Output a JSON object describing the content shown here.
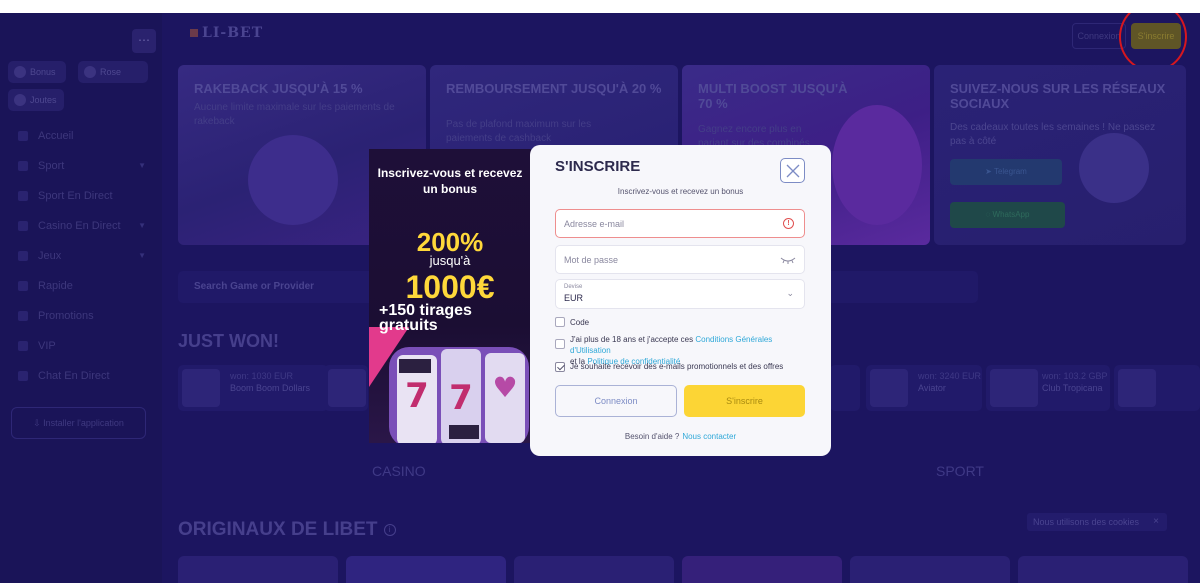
{
  "sidebar": {
    "chips": [
      "Bonus",
      "Rose",
      "Joutes"
    ],
    "items": [
      {
        "label": "Accueil",
        "chevron": false
      },
      {
        "label": "Sport",
        "chevron": true
      },
      {
        "label": "Sport En Direct",
        "chevron": false
      },
      {
        "label": "Casino En Direct",
        "chevron": true
      },
      {
        "label": "Jeux",
        "chevron": true
      },
      {
        "label": "Rapide",
        "chevron": false
      },
      {
        "label": "Promotions",
        "chevron": false
      },
      {
        "label": "VIP",
        "chevron": false
      },
      {
        "label": "Chat En Direct",
        "chevron": false
      }
    ],
    "install_label": "Installer l'application"
  },
  "header": {
    "logo": "LI-BET",
    "login_label": "Connexion",
    "signup_label": "S'inscrire"
  },
  "banners": [
    {
      "title": "RAKEBACK JUSQU'À 15 %",
      "text": "Aucune limite maximale sur les paiements de rakeback"
    },
    {
      "title": "REMBOURSEMENT JUSQU'À 20 %",
      "text": "Pas de plafond maximum sur les paiements de cashback"
    },
    {
      "title": "MULTI BOOST JUSQU'À 70 %",
      "text": "Gagnez encore plus en pariant sur des combinés"
    },
    {
      "title": "SUIVEZ-NOUS SUR LES RÉSEAUX SOCIAUX",
      "text": "Des cadeaux toutes les semaines ! Ne passez pas à côté",
      "buttons": [
        "Telegram",
        "WhatsApp"
      ]
    }
  ],
  "search": {
    "placeholder": "Search Game or Provider"
  },
  "just_won": {
    "title": "JUST WON!",
    "cards": [
      {
        "l1": "won: 1030 EUR",
        "l2": "Boom Boom Dollars"
      },
      {
        "l1": "won: 3240 EUR",
        "l2": "Aviator"
      },
      {
        "l1": "won: 103.2 GBP",
        "l2": "Club Tropicana"
      }
    ]
  },
  "tabs": {
    "casino": "CASINO",
    "sport": "SPORT"
  },
  "originaux": {
    "title": "ORIGINAUX DE LIBET",
    "info_icon": "i"
  },
  "cookie": {
    "text": "Nous utilisons des cookies",
    "close": "×"
  },
  "promo_panel": {
    "heading": "Inscrivez-vous et recevez un bonus",
    "percent": "200%",
    "up_to": "jusqu'à",
    "amount": "1000€",
    "spins": "+150 tirages gratuits"
  },
  "modal": {
    "title": "S'INSCRIRE",
    "subtitle": "Inscrivez-vous et recevez un bonus",
    "email_placeholder": "Adresse e-mail",
    "password_placeholder": "Mot de passe",
    "currency_label": "Devise",
    "currency_value": "EUR",
    "code_label": "Code",
    "terms_pre": "J'ai plus de 18 ans et j'accepte ces ",
    "terms_link": "Conditions Générales d'Utilisation",
    "terms_mid": "et la ",
    "privacy_link": "Politique de confidentialité",
    "promo_label": "Je souhaite recevoir des e-mails promotionnels et des offres",
    "login_button": "Connexion",
    "submit_button": "S'inscrire",
    "help_text": "Besoin d'aide ?",
    "help_link": "Nous contacter"
  }
}
